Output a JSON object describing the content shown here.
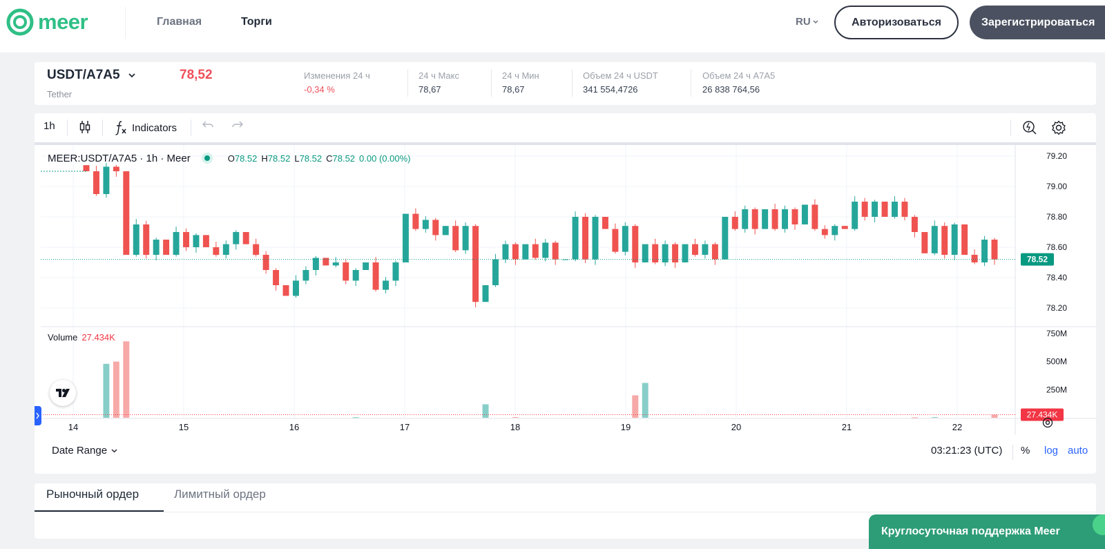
{
  "header": {
    "logo_text": "meer",
    "nav": [
      {
        "label": "Главная"
      },
      {
        "label": "Торги"
      }
    ],
    "lang": "RU",
    "login_label": "Авторизоваться",
    "register_label": "Зарегистрироваться",
    "brand_color": "#2fbf86"
  },
  "ticker": {
    "pair": "USDT/A7A5",
    "subtitle": "Tether",
    "price": "78,52",
    "stats": [
      {
        "label": "Изменения 24 ч",
        "value": "-0,34 %",
        "color": "#ef4f5a"
      },
      {
        "label": "24 ч Макс",
        "value": "78,67"
      },
      {
        "label": "24 ч Мин",
        "value": "78,67"
      },
      {
        "label": "Объем 24 ч USDT",
        "value": "341 554,4726"
      },
      {
        "label": "Объем 24 ч A7A5",
        "value": "26 838 764,56"
      }
    ]
  },
  "toolbar": {
    "interval": "1h",
    "indicators_label": "Indicators"
  },
  "legend": {
    "symbol": "MEER:USDT/A7A5 · 1h · Meer",
    "o_key": "O",
    "o": "78.52",
    "h_key": "H",
    "h": "78.52",
    "l_key": "L",
    "l": "78.52",
    "c_key": "C",
    "c": "78.52",
    "change": "0.00 (0.00%)",
    "volume_label": "Volume",
    "volume_value": "27.434K"
  },
  "bottom_bar": {
    "date_range": "Date Range",
    "clock": "03:21:23 (UTC)",
    "percent": "%",
    "log": "log",
    "auto": "auto"
  },
  "orders": {
    "tabs": [
      {
        "label": "Рыночный ордер"
      },
      {
        "label": "Лимитный ордер"
      }
    ]
  },
  "support_label": "Круглосуточная поддержка Meer",
  "chart_data": {
    "type": "candlestick",
    "x_ticks": [
      "14",
      "15",
      "16",
      "17",
      "18",
      "19",
      "20",
      "21",
      "22"
    ],
    "price_axis_ticks": [
      "79.20",
      "79.00",
      "78.80",
      "78.60",
      "78.40",
      "78.20"
    ],
    "price_ylim": [
      78.1,
      79.25
    ],
    "last_price_label": "78.52",
    "volume_axis_ticks": [
      "750M",
      "500M",
      "250M"
    ],
    "volume_ylim": [
      0,
      780
    ],
    "last_volume_label": "27.434K",
    "up_color": "#26a69a",
    "down_color": "#ef5350",
    "candles_close": [
      79.1,
      78.95,
      79.13,
      79.1,
      78.55,
      78.75,
      78.55,
      78.65,
      78.55,
      78.7,
      78.6,
      78.68,
      78.6,
      78.55,
      78.62,
      78.7,
      78.62,
      78.55,
      78.45,
      78.35,
      78.28,
      78.38,
      78.45,
      78.53,
      78.48,
      78.5,
      78.38,
      78.45,
      78.5,
      78.32,
      78.38,
      78.5,
      78.82,
      78.72,
      78.78,
      78.68,
      78.74,
      78.58,
      78.74,
      78.24,
      78.35,
      78.52,
      78.62,
      78.52,
      78.62,
      78.53,
      78.63,
      78.52,
      78.52,
      78.8,
      78.52,
      78.8,
      78.72,
      78.57,
      78.74,
      78.5,
      78.62,
      78.5,
      78.62,
      78.5,
      78.62,
      78.55,
      78.62,
      78.52,
      78.8,
      78.72,
      78.85,
      78.72,
      78.85,
      78.72,
      78.85,
      78.75,
      78.88,
      78.72,
      78.68,
      78.74,
      78.72,
      78.9,
      78.8,
      78.9,
      78.8,
      78.9,
      78.8,
      78.7,
      78.56,
      78.74,
      78.55,
      78.75,
      78.55,
      78.5,
      78.65,
      78.52
    ],
    "volumes": [
      0,
      0,
      480,
      500,
      680,
      0,
      0,
      0,
      0,
      0,
      0,
      0,
      0,
      0,
      0,
      0,
      0,
      0,
      0,
      0,
      0,
      0,
      0,
      0,
      0,
      0,
      0,
      5,
      0,
      0,
      0,
      0,
      0,
      0,
      0,
      0,
      0,
      0,
      0,
      0,
      120,
      0,
      0,
      6,
      0,
      0,
      0,
      0,
      0,
      0,
      0,
      0,
      0,
      0,
      0,
      200,
      310,
      0,
      0,
      0,
      0,
      0,
      0,
      0,
      0,
      0,
      0,
      0,
      0,
      0,
      0,
      0,
      0,
      0,
      0,
      0,
      0,
      0,
      0,
      0,
      0,
      0,
      0,
      4,
      0,
      6,
      0,
      0,
      0,
      0,
      0,
      27.434
    ]
  }
}
